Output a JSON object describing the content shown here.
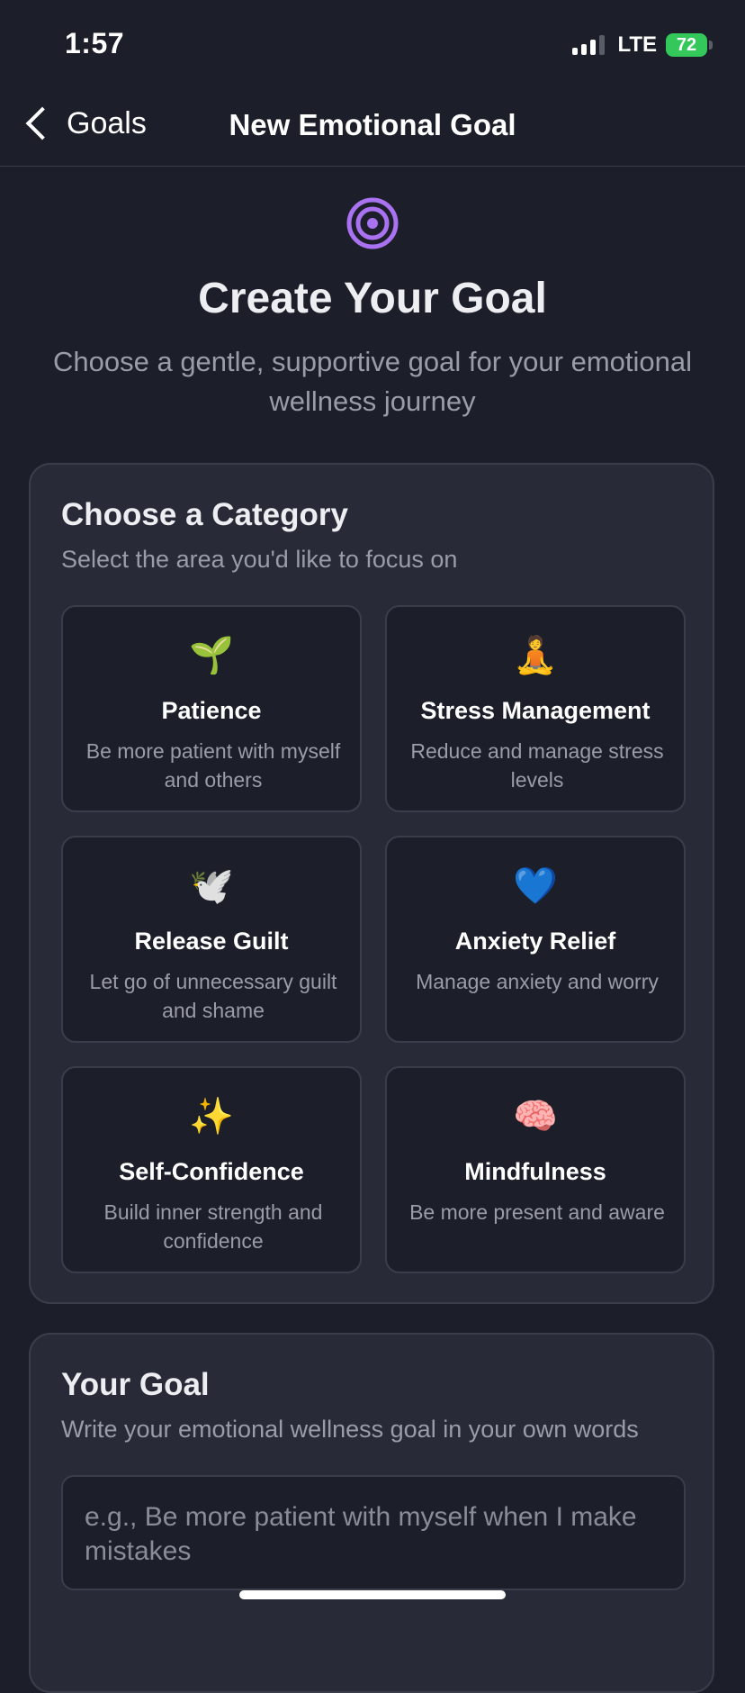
{
  "status_bar": {
    "time": "1:57",
    "network": "LTE",
    "battery": "72"
  },
  "nav": {
    "back_label": "Goals",
    "title": "New Emotional Goal"
  },
  "hero": {
    "icon": "target-icon",
    "title": "Create Your Goal",
    "subtitle": "Choose a gentle, supportive goal for your emotional wellness journey"
  },
  "category_section": {
    "title": "Choose a Category",
    "subtitle": "Select the area you'd like to focus on",
    "options": [
      {
        "icon": "seedling-icon",
        "emoji": "🌱",
        "title": "Patience",
        "description": "Be more patient with myself and others"
      },
      {
        "icon": "meditation-icon",
        "emoji": "🧘",
        "title": "Stress Management",
        "description": "Reduce and manage stress levels"
      },
      {
        "icon": "dove-icon",
        "emoji": "🕊️",
        "title": "Release Guilt",
        "description": "Let go of unnecessary guilt and shame"
      },
      {
        "icon": "blue-heart-icon",
        "emoji": "💙",
        "title": "Anxiety Relief",
        "description": "Manage anxiety and worry"
      },
      {
        "icon": "sparkles-icon",
        "emoji": "✨",
        "title": "Self-Confidence",
        "description": "Build inner strength and confidence"
      },
      {
        "icon": "brain-icon",
        "emoji": "🧠",
        "title": "Mindfulness",
        "description": "Be more present and aware"
      }
    ]
  },
  "goal_section": {
    "title": "Your Goal",
    "subtitle": "Write your emotional wellness goal in your own words",
    "input_value": "",
    "input_placeholder": "e.g., Be more patient with myself when I make mistakes"
  },
  "colors": {
    "background": "#1c1e29",
    "card": "#282b37",
    "accent": "#a872f0",
    "battery": "#34c759"
  }
}
